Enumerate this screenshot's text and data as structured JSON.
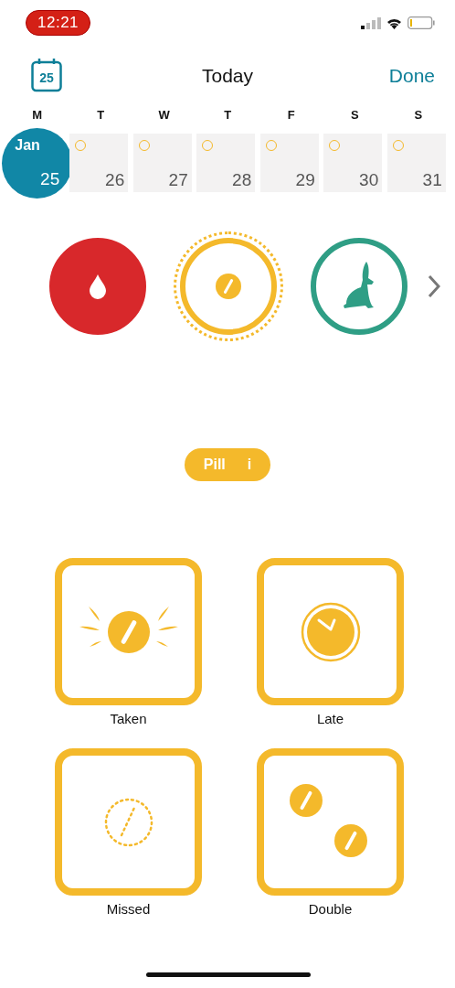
{
  "status_bar": {
    "time": "12:21"
  },
  "header": {
    "calendar_day": "25",
    "title": "Today",
    "done": "Done"
  },
  "week": {
    "days": [
      {
        "letter": "M",
        "month": "Jan",
        "date": "25",
        "selected": true
      },
      {
        "letter": "T",
        "date": "26",
        "selected": false
      },
      {
        "letter": "W",
        "date": "27",
        "selected": false
      },
      {
        "letter": "T",
        "date": "28",
        "selected": false
      },
      {
        "letter": "F",
        "date": "29",
        "selected": false
      },
      {
        "letter": "S",
        "date": "30",
        "selected": false
      },
      {
        "letter": "S",
        "date": "31",
        "selected": false
      }
    ]
  },
  "categories": [
    {
      "kind": "drop",
      "color": "#d8282b",
      "filled": true,
      "selected": false
    },
    {
      "kind": "pill",
      "color": "#f4b92b",
      "filled": false,
      "selected": true
    },
    {
      "kind": "rabbit",
      "color": "#2f9e85",
      "filled": false,
      "selected": false
    }
  ],
  "category_label": {
    "text": "Pill",
    "info": "i"
  },
  "options": [
    {
      "kind": "taken",
      "label": "Taken"
    },
    {
      "kind": "late",
      "label": "Late"
    },
    {
      "kind": "missed",
      "label": "Missed"
    },
    {
      "kind": "double",
      "label": "Double"
    }
  ]
}
